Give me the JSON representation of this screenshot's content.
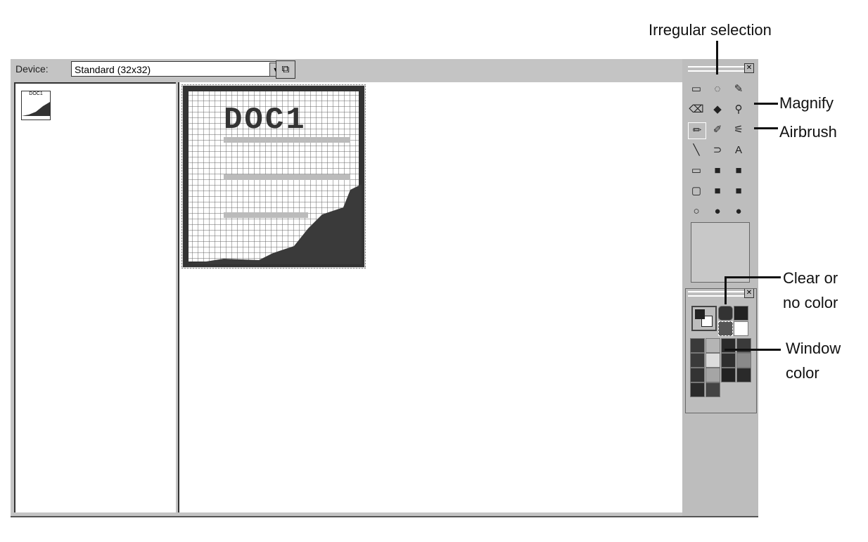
{
  "toolbar": {
    "device_label": "Device:",
    "device_value": "Standard (32x32)"
  },
  "thumbnail": {
    "label": "DOC1"
  },
  "icon": {
    "text": "DOC1",
    "size": "32x32"
  },
  "tools": [
    {
      "name": "rectangle-selection",
      "glyph": "▭"
    },
    {
      "name": "irregular-selection",
      "glyph": "◌"
    },
    {
      "name": "color-picker",
      "glyph": "✎"
    },
    {
      "name": "eraser",
      "glyph": "⌫"
    },
    {
      "name": "fill",
      "glyph": "◆"
    },
    {
      "name": "magnify",
      "glyph": "⚲"
    },
    {
      "name": "pencil",
      "glyph": "✏"
    },
    {
      "name": "brush",
      "glyph": "✐"
    },
    {
      "name": "airbrush",
      "glyph": "⚟"
    },
    {
      "name": "line",
      "glyph": "╲"
    },
    {
      "name": "curve",
      "glyph": "⊃"
    },
    {
      "name": "text",
      "glyph": "A"
    },
    {
      "name": "rectangle",
      "glyph": "▭"
    },
    {
      "name": "filled-rectangle-outline",
      "glyph": "■"
    },
    {
      "name": "filled-rectangle",
      "glyph": "■"
    },
    {
      "name": "rounded-rectangle",
      "glyph": "▢"
    },
    {
      "name": "filled-rounded-rectangle-outline",
      "glyph": "■"
    },
    {
      "name": "filled-rounded-rectangle",
      "glyph": "■"
    },
    {
      "name": "ellipse",
      "glyph": "○"
    },
    {
      "name": "filled-ellipse-outline",
      "glyph": "●"
    },
    {
      "name": "filled-ellipse",
      "glyph": "●"
    }
  ],
  "palette": [
    "#3a3a3a",
    "#b5b5b5",
    "#2a2a2a",
    "#3a3a3a",
    "#3a3a3a",
    "#dcdcdc",
    "#2e2e2e",
    "#8a8a8a",
    "#333",
    "#a5a5a5",
    "#222",
    "#2a2a2a",
    "#2a2a2a",
    "#444"
  ],
  "annotations": {
    "irregular": "Irregular selection",
    "magnify": "Magnify",
    "airbrush": "Airbrush",
    "clear1": "Clear or",
    "clear2": "no color",
    "window1": "Window",
    "window2": "color"
  }
}
